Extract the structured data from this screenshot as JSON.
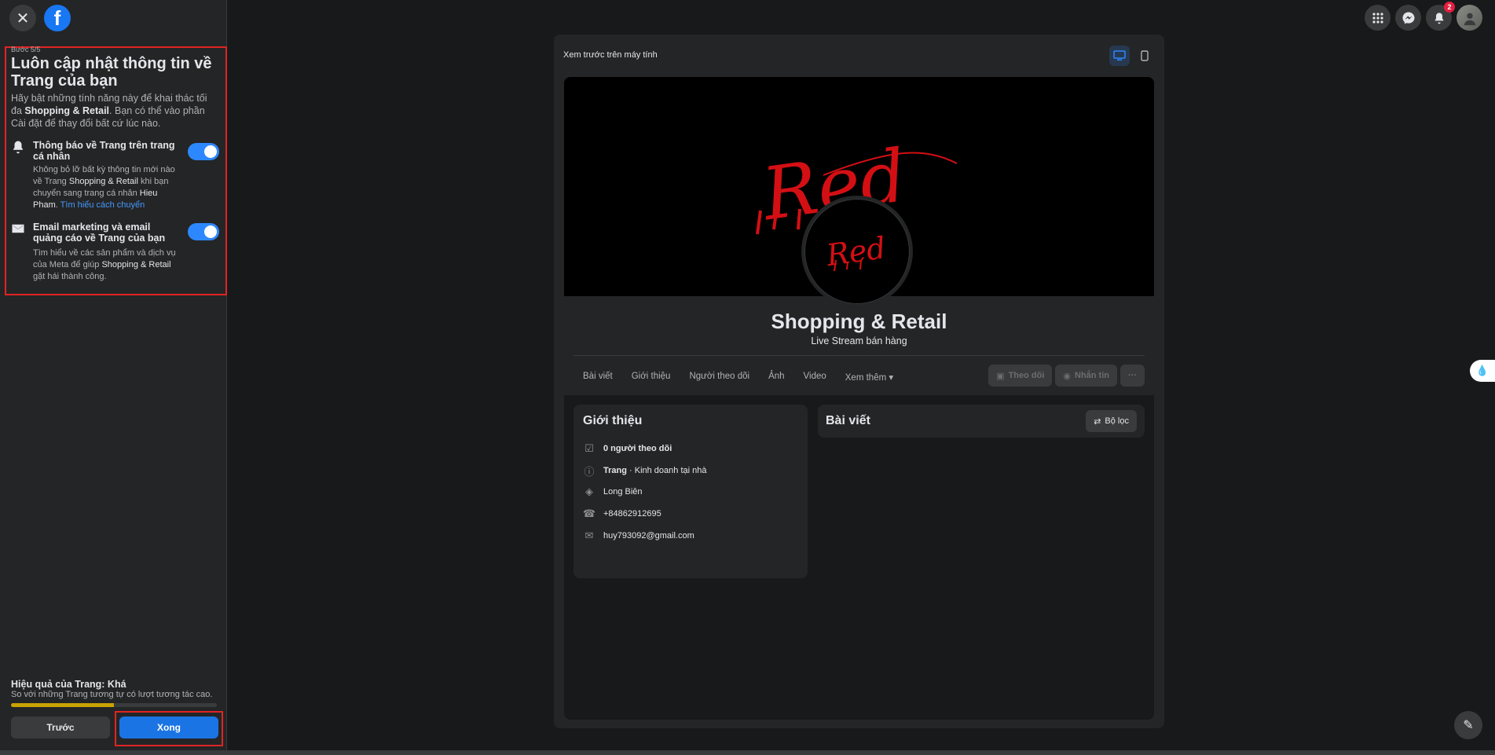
{
  "setup": {
    "step": "Bước 5/5",
    "title": "Luôn cập nhật thông tin về Trang của bạn",
    "desc_pre": "Hãy bật những tính năng này để khai thác tối đa ",
    "desc_bold": "Shopping & Retail",
    "desc_post": ". Bạn có thể vào phần Cài đặt để thay đổi bất cứ lúc nào.",
    "option1": {
      "title": "Thông báo về Trang trên trang cá nhân",
      "desc_a": "Không bỏ lỡ bất kỳ thông tin mới nào về Trang ",
      "desc_b": "Shopping & Retail",
      "desc_c": " khi bạn chuyển sang trang cá nhân ",
      "desc_d": "Hieu Pham",
      "desc_e": ". ",
      "link": "Tìm hiểu cách chuyển",
      "enabled": true
    },
    "option2": {
      "title": "Email marketing và email quảng cáo về Trang của bạn",
      "desc_a": "Tìm hiểu về các sản phẩm và dịch vụ của Meta để giúp ",
      "desc_b": "Shopping & Retail",
      "desc_c": " gặt hái thành công.",
      "enabled": true
    },
    "performance_title": "Hiệu quả của Trang: Khá",
    "performance_desc": "So với những Trang tương tự có lượt tương tác cao.",
    "performance_fraction": 0.5,
    "prev_label": "Trước",
    "done_label": "Xong"
  },
  "topbar": {
    "notification_count": "2"
  },
  "preview": {
    "label": "Xem trước trên máy tính",
    "page_name": "Shopping & Retail",
    "page_category": "Live Stream bán hàng",
    "cover_text": "Red",
    "tabs": [
      "Bài viết",
      "Giới thiệu",
      "Người theo dõi",
      "Ảnh",
      "Video",
      "Xem thêm"
    ],
    "follow_label": "Theo dõi",
    "message_label": "Nhắn tin",
    "more_label": "···",
    "intro_title": "Giới thiệu",
    "followers": "0 người theo dõi",
    "type_bold": "Trang",
    "type_rest": " · Kinh doanh tại nhà",
    "location": "Long Biên",
    "phone": "+84862912695",
    "email": "huy793092@gmail.com",
    "posts_title": "Bài viết",
    "filter_label": "Bộ lọc"
  },
  "colors": {
    "accent": "#2d88ff",
    "highlight": "#e02424",
    "logo_red": "#d40f14",
    "performance": "#c9a300"
  }
}
